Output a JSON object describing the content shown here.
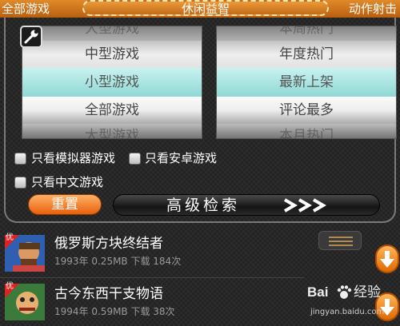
{
  "top_bar": {
    "left_tab": "全部游戏",
    "center_tab": "休闲益智",
    "right_tab": "动作射击"
  },
  "size_picker": {
    "items": [
      "大型游戏",
      "中型游戏",
      "小型游戏",
      "全部游戏",
      "大型游戏"
    ],
    "selected": "小型游戏"
  },
  "sort_picker": {
    "items": [
      "本周热门",
      "年度热门",
      "最新上架",
      "评论最多",
      "本月热门"
    ],
    "selected": "最新上架"
  },
  "checkboxes": {
    "emulator": "只看模拟器游戏",
    "android": "只看安卓游戏",
    "chinese": "只看中文游戏"
  },
  "buttons": {
    "reset": "重置",
    "advanced_search": "高级检索"
  },
  "games": [
    {
      "badge": "优",
      "title": "俄罗斯方块终结者",
      "meta": "1993年 0.25MB  下载 184次"
    },
    {
      "badge": "优",
      "title": "古今东西干支物语",
      "meta": "1994年 0.59MB  下载 38次"
    }
  ],
  "watermark": {
    "logo_left": "Bai",
    "logo_right": "经验",
    "url": "jingyan.baidu.com"
  },
  "colors": {
    "accent_orange": "#e08a2a",
    "selected_cyan": "#8fd8d4"
  }
}
